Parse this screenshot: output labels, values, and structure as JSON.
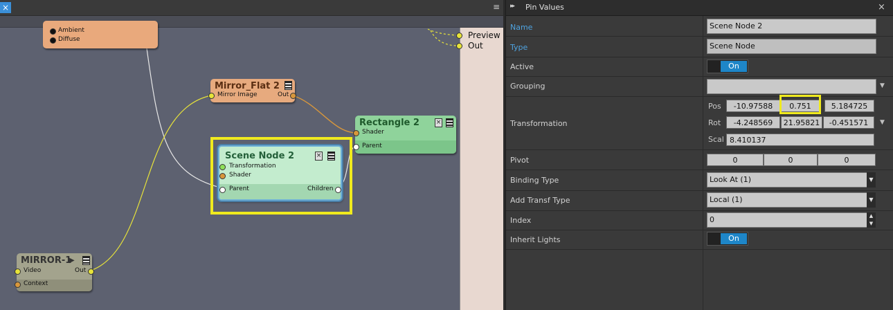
{
  "graph": {
    "close_icon": "×",
    "menu_icon": "≡",
    "output_pins": [
      "Preview",
      "Out"
    ],
    "nodes": {
      "top": {
        "pins": [
          "Ambient",
          "Diffuse"
        ]
      },
      "mirror_flat": {
        "title": "Mirror_Flat 2",
        "in_pin": "Mirror Image",
        "out_pin": "Out"
      },
      "rectangle": {
        "title": "Rectangle 2",
        "pins": [
          "Shader",
          "Parent"
        ]
      },
      "scene_node": {
        "title": "Scene Node 2",
        "pins": [
          "Transformation",
          "Shader"
        ],
        "parent": "Parent",
        "children": "Children"
      },
      "mirror1": {
        "title": "MIRROR-1",
        "play_icon": "▶",
        "pins": [
          "Video",
          "Context"
        ],
        "out_pin": "Out"
      }
    },
    "colors": {
      "canvas": "#5d6170",
      "highlight": "#f0ea1e",
      "wire_yellow": "#e7e33a",
      "wire_orange": "#d8973c",
      "wire_white": "#e8e8e8"
    }
  },
  "panel": {
    "arrows": "▸▸",
    "title": "Pin Values",
    "close": "×",
    "rows": {
      "name": {
        "label": "Name",
        "value": "Scene Node 2"
      },
      "type": {
        "label": "Type",
        "value": "Scene Node"
      },
      "active": {
        "label": "Active",
        "toggle": "On"
      },
      "grouping": {
        "label": "Grouping",
        "value": ""
      },
      "transformation": {
        "label": "Transformation",
        "pos_label": "Pos",
        "pos": [
          "-10.97588",
          "0.751",
          "5.184725"
        ],
        "rot_label": "Rot",
        "rot": [
          "-4.248569",
          "21.95821",
          "-0.451571"
        ],
        "scal_label": "Scal",
        "scal": "8.410137"
      },
      "pivot": {
        "label": "Pivot",
        "values": [
          "0",
          "0",
          "0"
        ]
      },
      "binding_type": {
        "label": "Binding Type",
        "value": "Look At (1)"
      },
      "add_transf_type": {
        "label": "Add Transf Type",
        "value": "Local (1)"
      },
      "index": {
        "label": "Index",
        "value": "0"
      },
      "inherit_lights": {
        "label": "Inherit Lights",
        "toggle": "On"
      }
    },
    "colors": {
      "accent_label": "#4fa3e0",
      "toggle_on": "#1e86c8"
    }
  }
}
